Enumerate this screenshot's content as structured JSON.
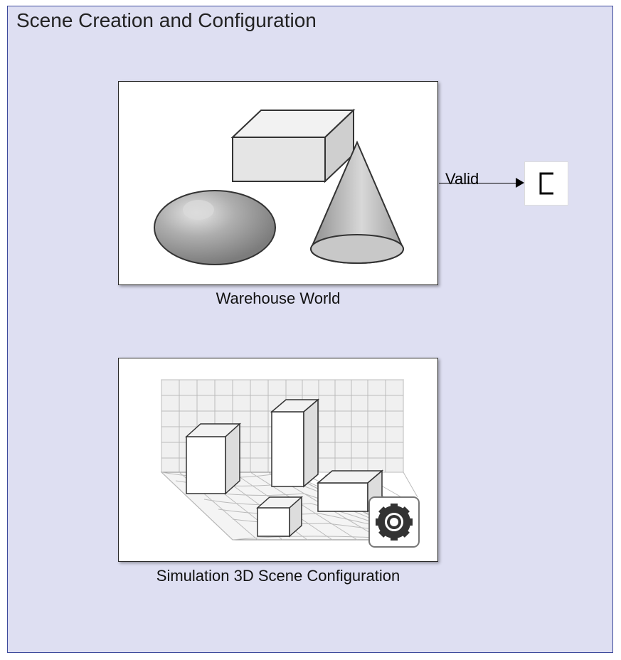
{
  "panel": {
    "title": "Scene Creation and Configuration"
  },
  "blocks": {
    "warehouse": {
      "label": "Warehouse World"
    },
    "sceneconfig": {
      "label": "Simulation 3D Scene Configuration"
    }
  },
  "port": {
    "valid_label": "Valid"
  }
}
